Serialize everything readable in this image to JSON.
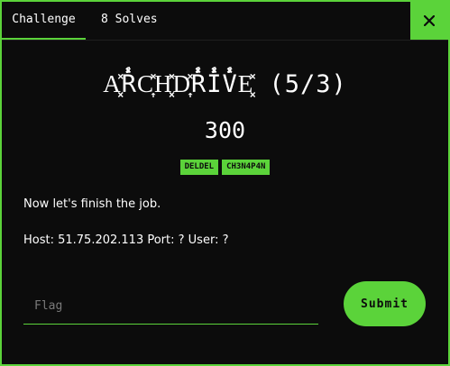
{
  "tabs": [
    {
      "label": "Challenge"
    },
    {
      "label": "8 Solves"
    }
  ],
  "close_icon": "close-icon",
  "accent_color": "#5bd33a",
  "challenge": {
    "name": "A͓̽R̽̾C͎̽H͓̽D͎̽R̽̾I̽̾V̽̾E͓̽ (5/3)",
    "points": "300",
    "tags": [
      "DELDEL",
      "CH3N4P4N"
    ],
    "description_line1": "Now let's finish the job.",
    "description_line2": "Host: 51.75.202.113 Port: ? User: ?"
  },
  "form": {
    "flag_placeholder": "Flag",
    "submit_label": "Submit"
  }
}
